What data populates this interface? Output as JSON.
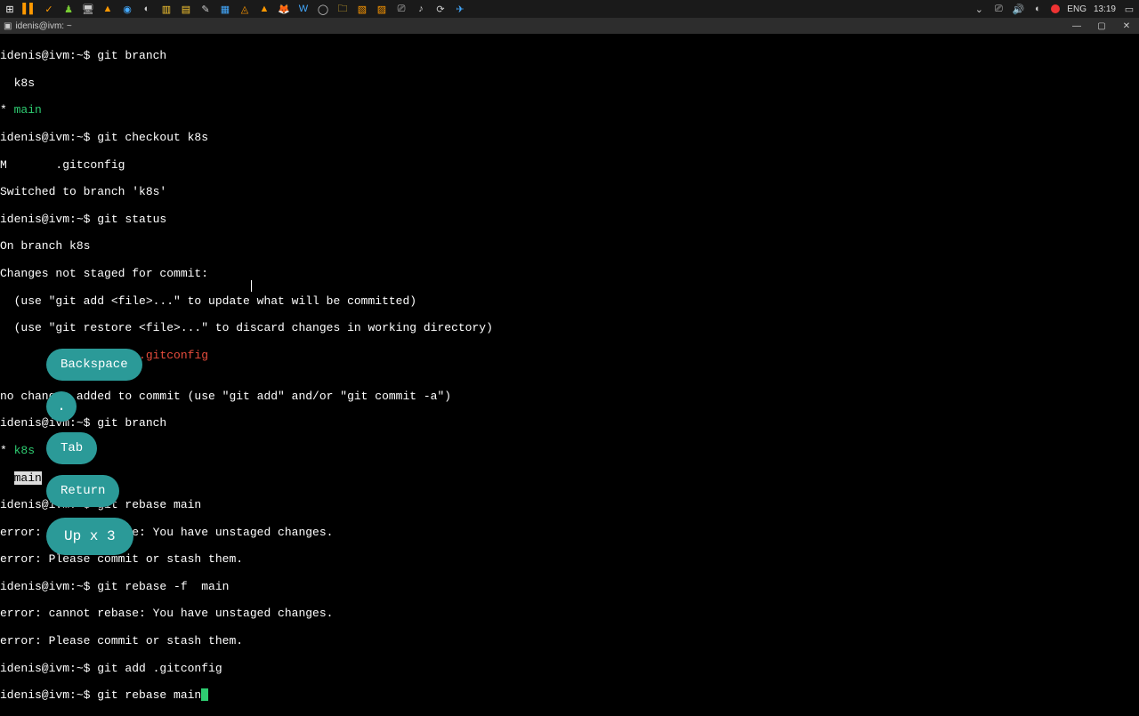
{
  "taskbar": {
    "left_icons": [
      "win",
      "intellij",
      "check",
      "person",
      "screen",
      "vlc",
      "edge",
      "teams",
      "file",
      "notepad",
      "notepad2",
      "zip",
      "tri",
      "vlc2",
      "firefox",
      "word",
      "chrome",
      "folder",
      "xl",
      "pp",
      "term",
      "sound",
      "refresh",
      "telegram"
    ],
    "right": {
      "lang": "ENG",
      "time": "13:19"
    }
  },
  "titlebar": {
    "title": "idenis@ivm: ~"
  },
  "terminal": {
    "l1_prompt": "idenis@ivm:~$ ",
    "l1_cmd": "git branch",
    "l2": "  k8s",
    "l3_star": "* ",
    "l3_main": "main",
    "l4_prompt": "idenis@ivm:~$ ",
    "l4_cmd": "git checkout k8s",
    "l5": "M       .gitconfig",
    "l6": "Switched to branch 'k8s'",
    "l7_prompt": "idenis@ivm:~$ ",
    "l7_cmd": "git status",
    "l8": "On branch k8s",
    "l9": "Changes not staged for commit:",
    "l10": "  (use \"git add <file>...\" to update what will be committed)",
    "l11": "  (use \"git restore <file>...\" to discard changes in working directory)",
    "l12_pad": "        ",
    "l12_red": "modified:   .gitconfig",
    "l13": "",
    "l14": "no changes added to commit (use \"git add\" and/or \"git commit -a\")",
    "l15_prompt": "idenis@ivm:~$ ",
    "l15_cmd": "git branch",
    "l16_star": "* ",
    "l16_k8s": "k8s",
    "l17_pad": "  ",
    "l17_main_sel": "main",
    "l18_prompt": "idenis@ivm:~$ ",
    "l18_cmd": "git rebase main",
    "l19": "error: cannot rebase: You have unstaged changes.",
    "l20": "error: Please commit or stash them.",
    "l21_prompt": "idenis@ivm:~$ ",
    "l21_cmd": "git rebase -f  main",
    "l22": "error: cannot rebase: You have unstaged changes.",
    "l23": "error: Please commit or stash them.",
    "l24_prompt": "idenis@ivm:~$ ",
    "l24_cmd": "git add .gitconfig",
    "l25_prompt": "idenis@ivm:~$ ",
    "l25_cmd": "git rebase main"
  },
  "keys": {
    "backspace": "Backspace",
    "dot": ".",
    "tab": "Tab",
    "return": "Return",
    "up": "Up x 3"
  }
}
